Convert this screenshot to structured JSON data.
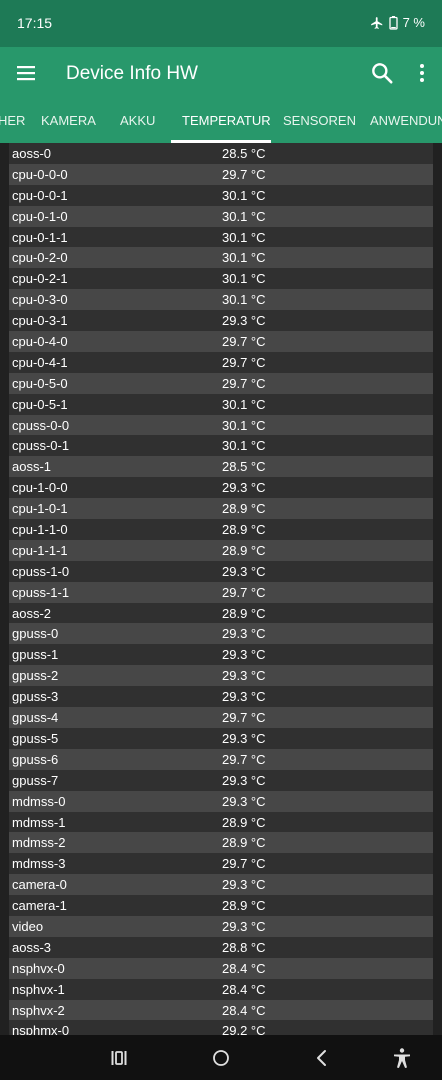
{
  "status_bar": {
    "time": "17:15",
    "battery": "7 %"
  },
  "app_bar": {
    "title": "Device Info HW"
  },
  "tabs": [
    {
      "label": "HER",
      "active": false
    },
    {
      "label": "KAMERA",
      "active": false
    },
    {
      "label": "AKKU",
      "active": false
    },
    {
      "label": "TEMPERATUR",
      "active": true
    },
    {
      "label": "SENSOREN",
      "active": false
    },
    {
      "label": "ANWENDUNGEN",
      "active": false
    }
  ],
  "rows": [
    {
      "name": "aoss-0",
      "temp": "28.5 °C"
    },
    {
      "name": "cpu-0-0-0",
      "temp": "29.7 °C"
    },
    {
      "name": "cpu-0-0-1",
      "temp": "30.1 °C"
    },
    {
      "name": "cpu-0-1-0",
      "temp": "30.1 °C"
    },
    {
      "name": "cpu-0-1-1",
      "temp": "30.1 °C"
    },
    {
      "name": "cpu-0-2-0",
      "temp": "30.1 °C"
    },
    {
      "name": "cpu-0-2-1",
      "temp": "30.1 °C"
    },
    {
      "name": "cpu-0-3-0",
      "temp": "30.1 °C"
    },
    {
      "name": "cpu-0-3-1",
      "temp": "29.3 °C"
    },
    {
      "name": "cpu-0-4-0",
      "temp": "29.7 °C"
    },
    {
      "name": "cpu-0-4-1",
      "temp": "29.7 °C"
    },
    {
      "name": "cpu-0-5-0",
      "temp": "29.7 °C"
    },
    {
      "name": "cpu-0-5-1",
      "temp": "30.1 °C"
    },
    {
      "name": "cpuss-0-0",
      "temp": "30.1 °C"
    },
    {
      "name": "cpuss-0-1",
      "temp": "30.1 °C"
    },
    {
      "name": "aoss-1",
      "temp": "28.5 °C"
    },
    {
      "name": "cpu-1-0-0",
      "temp": "29.3 °C"
    },
    {
      "name": "cpu-1-0-1",
      "temp": "28.9 °C"
    },
    {
      "name": "cpu-1-1-0",
      "temp": "28.9 °C"
    },
    {
      "name": "cpu-1-1-1",
      "temp": "28.9 °C"
    },
    {
      "name": "cpuss-1-0",
      "temp": "29.3 °C"
    },
    {
      "name": "cpuss-1-1",
      "temp": "29.7 °C"
    },
    {
      "name": "aoss-2",
      "temp": "28.9 °C"
    },
    {
      "name": "gpuss-0",
      "temp": "29.3 °C"
    },
    {
      "name": "gpuss-1",
      "temp": "29.3 °C"
    },
    {
      "name": "gpuss-2",
      "temp": "29.3 °C"
    },
    {
      "name": "gpuss-3",
      "temp": "29.3 °C"
    },
    {
      "name": "gpuss-4",
      "temp": "29.7 °C"
    },
    {
      "name": "gpuss-5",
      "temp": "29.3 °C"
    },
    {
      "name": "gpuss-6",
      "temp": "29.7 °C"
    },
    {
      "name": "gpuss-7",
      "temp": "29.3 °C"
    },
    {
      "name": "mdmss-0",
      "temp": "29.3 °C"
    },
    {
      "name": "mdmss-1",
      "temp": "28.9 °C"
    },
    {
      "name": "mdmss-2",
      "temp": "28.9 °C"
    },
    {
      "name": "mdmss-3",
      "temp": "29.7 °C"
    },
    {
      "name": "camera-0",
      "temp": "29.3 °C"
    },
    {
      "name": "camera-1",
      "temp": "28.9 °C"
    },
    {
      "name": "video",
      "temp": "29.3 °C"
    },
    {
      "name": "aoss-3",
      "temp": "28.8 °C"
    },
    {
      "name": "nsphvx-0",
      "temp": "28.4 °C"
    },
    {
      "name": "nsphvx-1",
      "temp": "28.4 °C"
    },
    {
      "name": "nsphvx-2",
      "temp": "28.4 °C"
    },
    {
      "name": "nsphmx-0",
      "temp": "29.2 °C"
    }
  ],
  "colors": {
    "status_bar": "#1e7a56",
    "app_bar": "#28986b",
    "row_odd": "#303030",
    "row_even": "#474747",
    "background": "#212121"
  }
}
